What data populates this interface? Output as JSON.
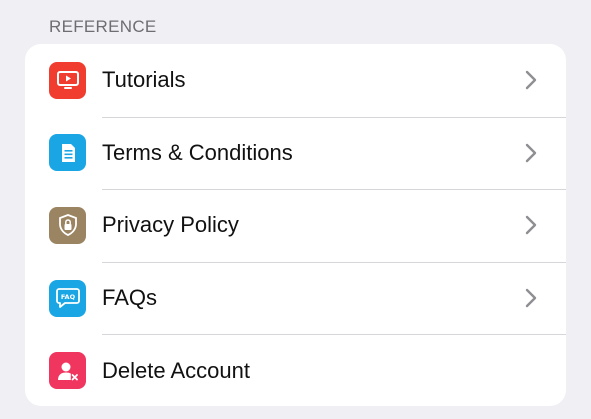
{
  "section": {
    "title": "REFERENCE"
  },
  "colors": {
    "tutorials": "#f03d2f",
    "terms": "#1aa6e4",
    "privacy": "#9b8462",
    "faqs": "#1aa6e4",
    "delete": "#f0355f",
    "chevron": "#8e8e93"
  },
  "items": [
    {
      "label": "Tutorials",
      "icon": "tv-play-icon",
      "has_chevron": true
    },
    {
      "label": "Terms & Conditions",
      "icon": "document-icon",
      "has_chevron": true
    },
    {
      "label": "Privacy Policy",
      "icon": "shield-lock-icon",
      "has_chevron": true
    },
    {
      "label": "FAQs",
      "icon": "faq-bubble-icon",
      "has_chevron": true
    },
    {
      "label": "Delete Account",
      "icon": "user-delete-icon",
      "has_chevron": false
    }
  ]
}
